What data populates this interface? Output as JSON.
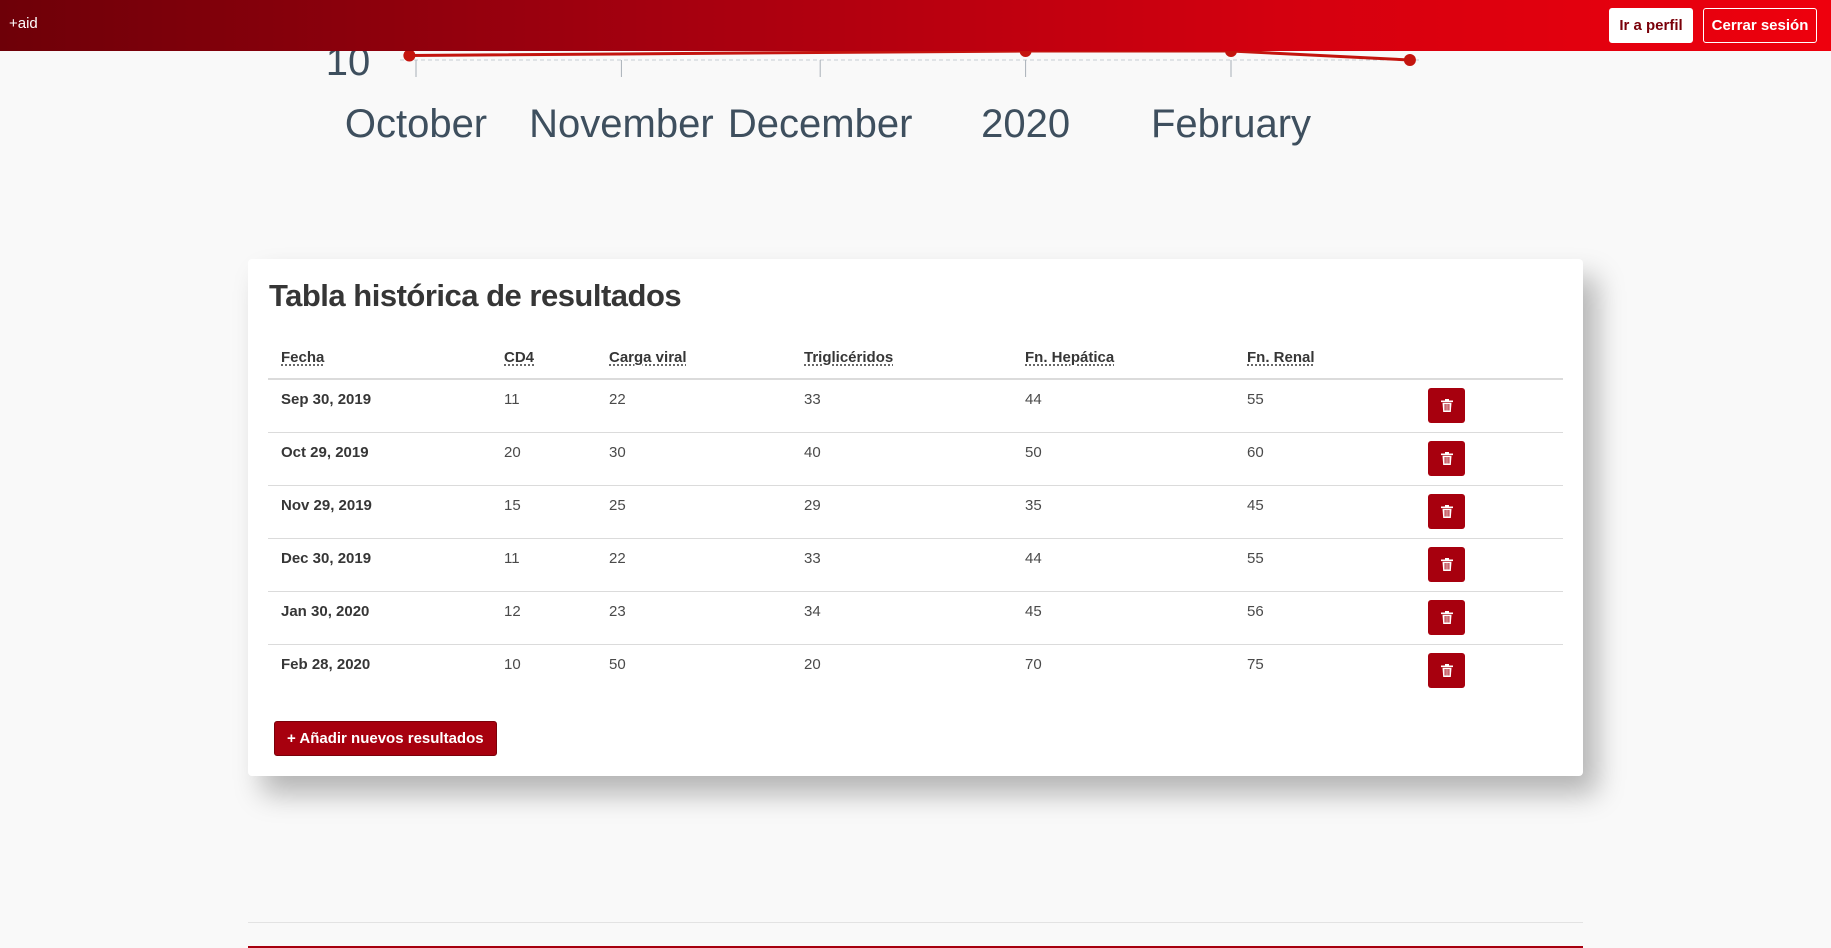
{
  "header": {
    "brand": "+aid",
    "profile_button": "Ir a perfil",
    "logout_button": "Cerrar sesión"
  },
  "chart_data": {
    "type": "line",
    "x": [
      "Oct 1, 2019",
      "Nov 1, 2019",
      "Dec 1, 2019",
      "Jan 1, 2020",
      "Feb 1, 2020",
      "Feb 28, 2020"
    ],
    "x_tick_labels": [
      "October",
      "November",
      "December",
      "2020",
      "February"
    ],
    "y_visible_tick_labels": [
      "10"
    ],
    "series": [
      {
        "color": "#c4140e",
        "x": [
          "Sep 30, 2019",
          "Jan 1, 2020",
          "Feb 1, 2020",
          "Feb 28, 2020"
        ],
        "values": [
          11,
          12,
          12,
          10
        ]
      }
    ],
    "grid": true
  },
  "table": {
    "title": "Tabla histórica de resultados",
    "columns": [
      "Fecha",
      "CD4",
      "Carga viral",
      "Triglicéridos",
      "Fn. Hepática",
      "Fn. Renal"
    ],
    "rows": [
      {
        "fecha": "Sep 30, 2019",
        "cd4": "11",
        "carga_viral": "22",
        "trigliceridos": "33",
        "fn_hepatica": "44",
        "fn_renal": "55"
      },
      {
        "fecha": "Oct 29, 2019",
        "cd4": "20",
        "carga_viral": "30",
        "trigliceridos": "40",
        "fn_hepatica": "50",
        "fn_renal": "60"
      },
      {
        "fecha": "Nov 29, 2019",
        "cd4": "15",
        "carga_viral": "25",
        "trigliceridos": "29",
        "fn_hepatica": "35",
        "fn_renal": "45"
      },
      {
        "fecha": "Dec 30, 2019",
        "cd4": "11",
        "carga_viral": "22",
        "trigliceridos": "33",
        "fn_hepatica": "44",
        "fn_renal": "55"
      },
      {
        "fecha": "Jan 30, 2020",
        "cd4": "12",
        "carga_viral": "23",
        "trigliceridos": "34",
        "fn_hepatica": "45",
        "fn_renal": "56"
      },
      {
        "fecha": "Feb 28, 2020",
        "cd4": "10",
        "carga_viral": "50",
        "trigliceridos": "20",
        "fn_hepatica": "70",
        "fn_renal": "75"
      }
    ],
    "delete_icon": "trash-icon",
    "add_button": "+ Añadir nuevos resultados"
  },
  "colors": {
    "primary": "#a7000e",
    "header_start": "#6e0008",
    "header_end": "#ee000d",
    "line": "#c4140e"
  }
}
